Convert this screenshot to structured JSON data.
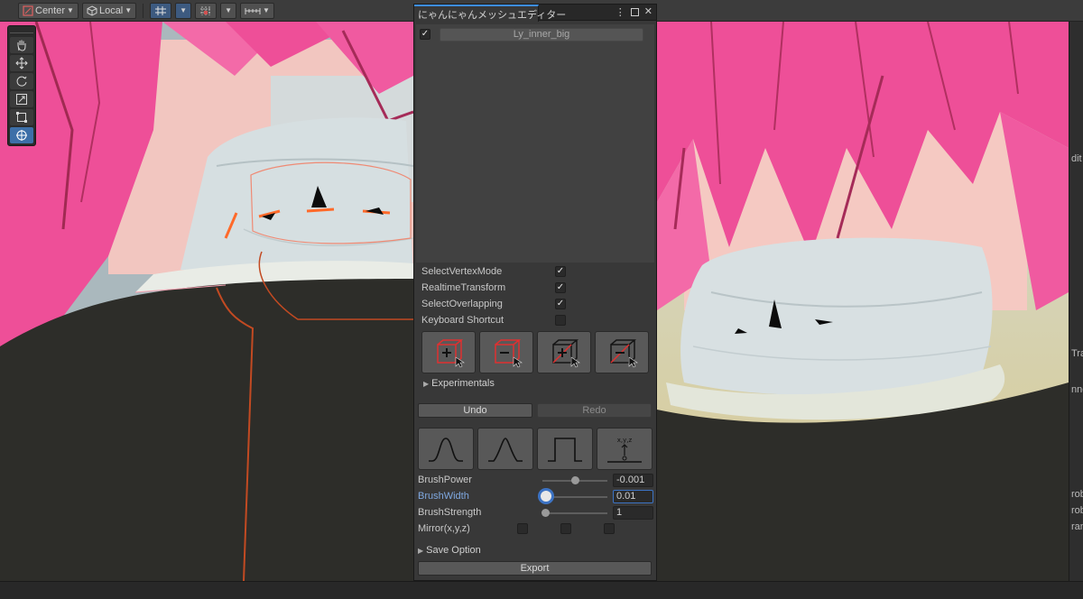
{
  "toolbar": {
    "pivot_label": "Center",
    "space_label": "Local"
  },
  "editor": {
    "title": "にゃんにゃんメッシュエディター",
    "mesh_list": [
      {
        "name": "Ly_inner_big",
        "enabled": true
      }
    ],
    "options": [
      {
        "label": "SelectVertexMode",
        "checked": true
      },
      {
        "label": "RealtimeTransform",
        "checked": true
      },
      {
        "label": "SelectOverlapping",
        "checked": true
      },
      {
        "label": "Keyboard Shortcut",
        "checked": false
      }
    ],
    "experimentals_label": "Experimentals",
    "undo_label": "Undo",
    "redo_label": "Redo",
    "brush_icon_text": "x,y,z",
    "brush_power": {
      "label": "BrushPower",
      "value": "-0.001",
      "fraction": 0.5
    },
    "brush_width": {
      "label": "BrushWidth",
      "value": "0.01",
      "fraction": 0.06
    },
    "brush_strength": {
      "label": "BrushStrength",
      "value": "1",
      "fraction": 0.05
    },
    "mirror": {
      "label": "Mirror(x,y,z)",
      "x": false,
      "y": false,
      "z": false
    },
    "save_option_label": "Save Option",
    "export_label": "Export"
  },
  "inspector_fragments": [
    "dit I",
    "Tra",
    "nne",
    "rob",
    "rob",
    "ran"
  ],
  "colors": {
    "accent": "#3d8eea",
    "hair": "#f0509a",
    "collar": "#d4dcde",
    "jacket": "#2c2c28"
  }
}
